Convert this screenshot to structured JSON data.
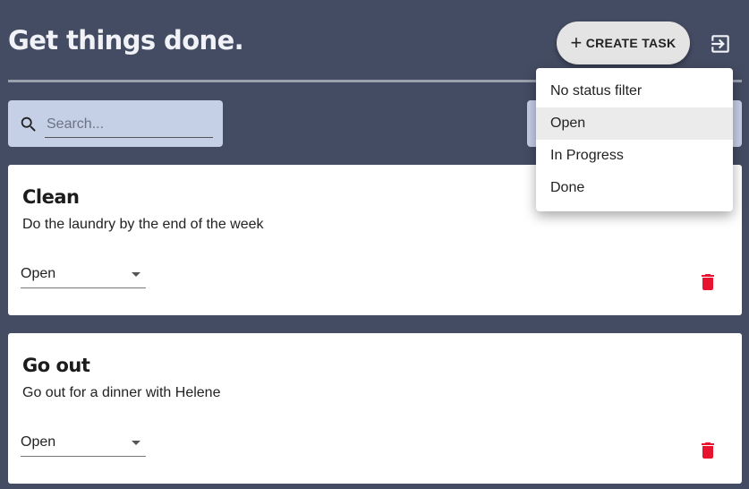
{
  "header": {
    "title": "Get things done.",
    "create_label": "CREATE TASK",
    "create_icon": "plus-icon",
    "logout_icon": "logout-icon"
  },
  "search": {
    "placeholder": "Search...",
    "icon": "search-icon"
  },
  "status_menu": {
    "items": [
      {
        "label": "No status filter",
        "selected": false
      },
      {
        "label": "Open",
        "selected": true
      },
      {
        "label": "In Progress",
        "selected": false
      },
      {
        "label": "Done",
        "selected": false
      }
    ]
  },
  "tasks": [
    {
      "title": "Clean",
      "description": "Do the laundry by the end of the week",
      "status": "Open"
    },
    {
      "title": "Go out",
      "description": "Go out for a dinner with Helene",
      "status": "Open"
    }
  ],
  "colors": {
    "background": "#444c63",
    "field": "#c5cfe6",
    "delete": "#e8132f"
  }
}
